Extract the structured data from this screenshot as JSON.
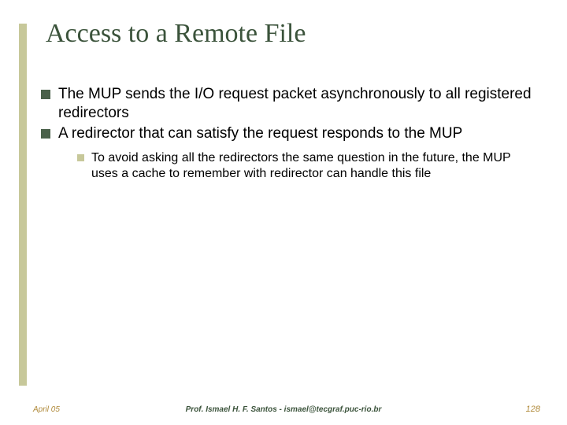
{
  "title": "Access to a Remote File",
  "bullets": [
    {
      "text": "The MUP sends the I/O request packet asynchronously to all registered redirectors"
    },
    {
      "text": "A redirector that can satisfy the request responds to the MUP"
    }
  ],
  "subbullet": {
    "text": "To avoid asking all the redirectors the same question in the future, the MUP uses a cache to remember with redirector can handle this file"
  },
  "footer": {
    "date": "April 05",
    "author": "Prof. Ismael H. F. Santos  -  ismael@tecgraf.puc-rio.br",
    "page": "128"
  }
}
